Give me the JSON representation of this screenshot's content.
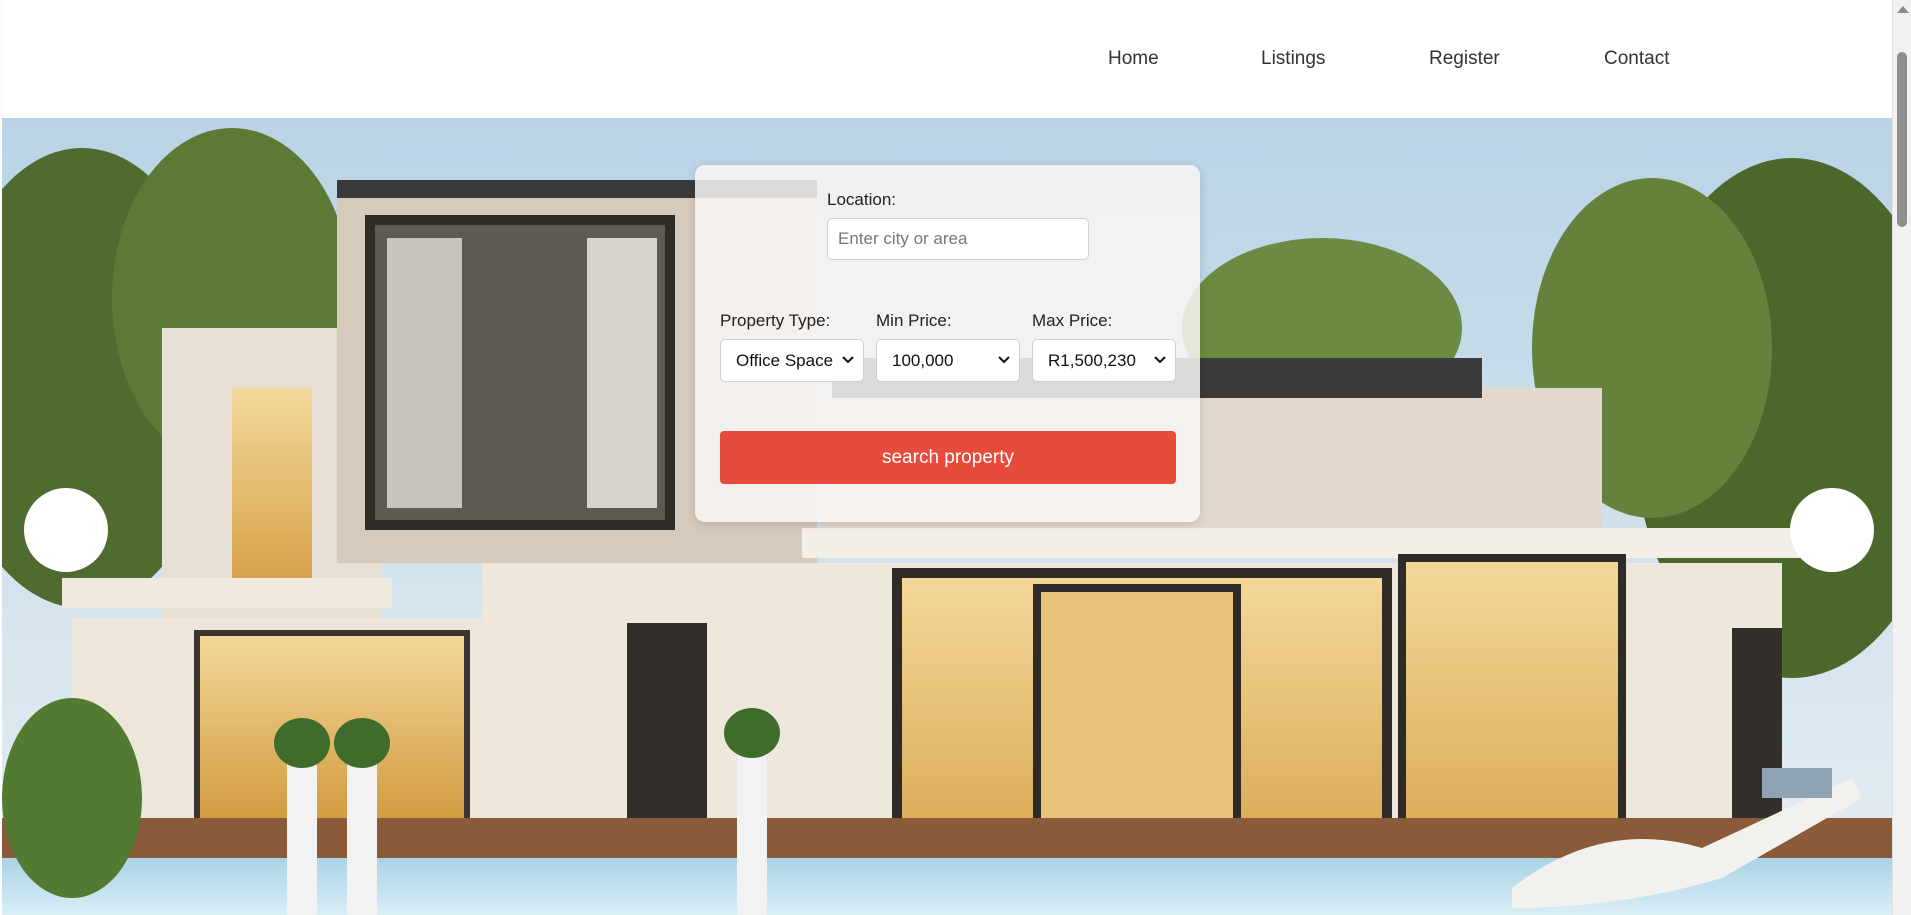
{
  "nav": {
    "items": [
      {
        "label": "Home"
      },
      {
        "label": "Listings"
      },
      {
        "label": "Register"
      },
      {
        "label": "Contact"
      }
    ]
  },
  "hero": {
    "image": "modern-house-photo",
    "prev_icon": "circle-prev-button",
    "next_icon": "circle-next-button"
  },
  "search": {
    "location_label": "Location:",
    "location_placeholder": "Enter city or area",
    "location_value": "",
    "property_type_label": "Property Type:",
    "property_type_value": "Office Space",
    "min_price_label": "Min Price:",
    "min_price_value": "100,000",
    "max_price_label": "Max Price:",
    "max_price_value": "R1,500,230",
    "button_label": "search property"
  },
  "colors": {
    "accent": "#e74b3c",
    "nav_text": "#333333"
  }
}
